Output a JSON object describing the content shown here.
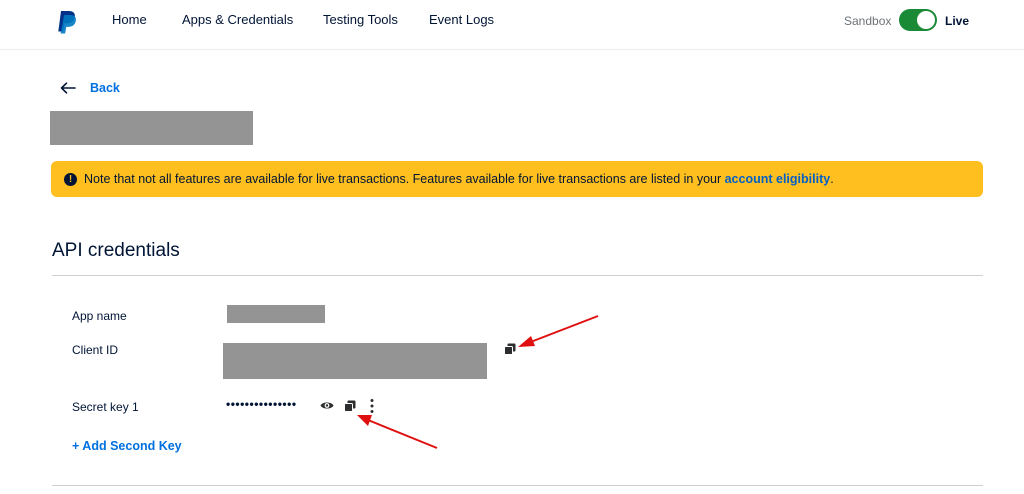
{
  "nav": {
    "logo": "paypal-logo-icon",
    "items": [
      {
        "label": "Home"
      },
      {
        "label": "Apps & Credentials"
      },
      {
        "label": "Testing Tools"
      },
      {
        "label": "Event Logs"
      }
    ],
    "environment": {
      "sandbox_label": "Sandbox",
      "live_label": "Live",
      "live_enabled": true,
      "toggle_color": "#1b8a36"
    }
  },
  "back": {
    "label": "Back",
    "icon": "arrow-left-icon"
  },
  "notice": {
    "text": "Note that not all features are available for live transactions. Features available for live transactions are listed in your ",
    "link_label": "account eligibility",
    "suffix": ".",
    "background": "#ffbf1f",
    "icon": "exclamation-icon"
  },
  "credentials": {
    "title": "API credentials",
    "app_name_label": "App name",
    "client_id_label": "Client ID",
    "secret_key_label": "Secret key 1",
    "secret_mask": "•••••••••••••••",
    "add_key_label": "+ Add Second Key",
    "icons": [
      "copy-icon",
      "eye-icon",
      "more-vertical-icon"
    ]
  },
  "colors": {
    "link": "#0070e0",
    "text": "#001435",
    "redaction": "#949494",
    "annotation_arrow": "#e01010"
  }
}
